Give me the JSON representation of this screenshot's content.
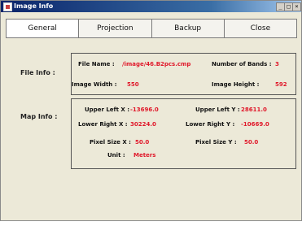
{
  "window": {
    "title": "Image Info"
  },
  "titlebar_controls": {
    "min": "_",
    "max": "□",
    "close": "×"
  },
  "tabs": [
    {
      "label": "General"
    },
    {
      "label": "Projection"
    },
    {
      "label": "Backup"
    },
    {
      "label": "Close"
    }
  ],
  "file_info": {
    "heading": "File Info :",
    "file_name_label": "File Name :",
    "file_name_value": "/image/46.B2pcs.cmp",
    "bands_label": "Number of Bands :",
    "bands_value": "3",
    "width_label": "Image Width :",
    "width_value": "550",
    "height_label": "Image Height :",
    "height_value": "592"
  },
  "map_info": {
    "heading": "Map Info :",
    "upper_left_x_label": "Upper Left X :",
    "upper_left_x_value": "-13696.0",
    "upper_left_y_label": "Upper Left Y :",
    "upper_left_y_value": "28611.0",
    "lower_right_x_label": "Lower Right X :",
    "lower_right_x_value": "30224.0",
    "lower_right_y_label": "Lower Right Y :",
    "lower_right_y_value": "-10669.0",
    "pixel_size_x_label": "Pixel Size X :",
    "pixel_size_x_value": "50.0",
    "pixel_size_y_label": "Pixel Size Y :",
    "pixel_size_y_value": "50.0",
    "unit_label": "Unit :",
    "unit_value": "Meters"
  },
  "colors": {
    "value_text": "#e0182a",
    "titlebar_start": "#0a246a",
    "window_bg": "#ece9d8"
  }
}
